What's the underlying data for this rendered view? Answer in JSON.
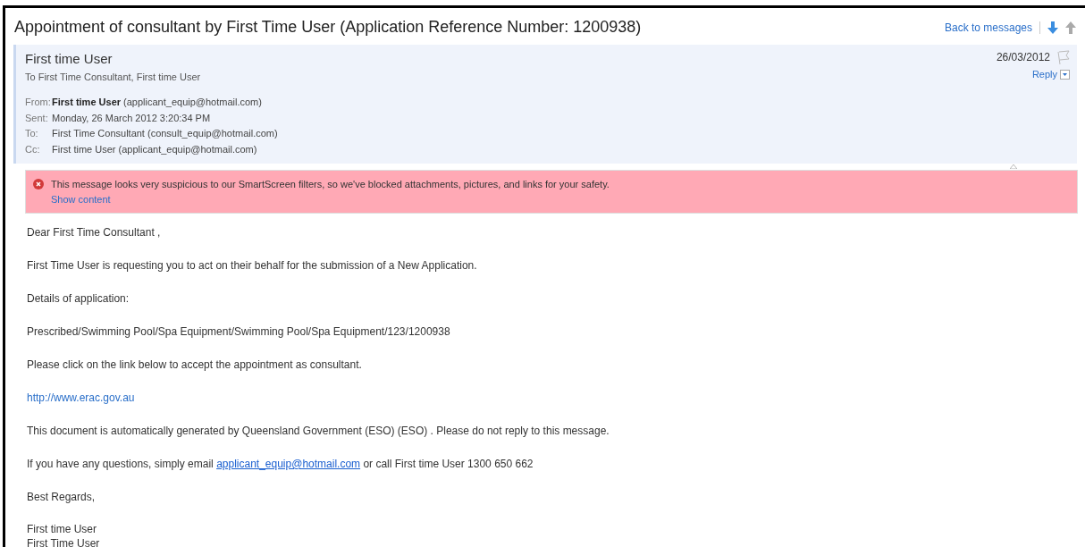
{
  "subject": "Appointment of consultant by First Time User (Application Reference Number: 1200938)",
  "back_link": "Back to messages",
  "header": {
    "sender": "First time User",
    "recipients": "To First Time Consultant, First time User",
    "date": "26/03/2012",
    "reply": "Reply",
    "details": [
      {
        "label": "From:",
        "bold": "First time User",
        "value": "(applicant_equip@hotmail.com)"
      },
      {
        "label": "Sent:",
        "value": "Monday, 26 March 2012 3:20:34 PM"
      },
      {
        "label": "To:",
        "value": "First Time Consultant (consult_equip@hotmail.com)"
      },
      {
        "label": "Cc:",
        "value": "First time User (applicant_equip@hotmail.com)"
      }
    ]
  },
  "warning": {
    "text": "This message looks very suspicious to our SmartScreen filters, so we've blocked attachments, pictures, and links for your safety.",
    "link": "Show content"
  },
  "body": [
    {
      "kind": "text",
      "text": "Dear First Time Consultant ,"
    },
    {
      "kind": "text",
      "text": "First Time User is requesting you to act on their behalf for the submission of a New Application."
    },
    {
      "kind": "text",
      "text": "Details of application:"
    },
    {
      "kind": "text",
      "text": "Prescribed/Swimming Pool/Spa Equipment/Swimming Pool/Spa Equipment/123/1200938"
    },
    {
      "kind": "text",
      "text": "Please click on the link below to accept the appointment as consultant."
    },
    {
      "kind": "link",
      "text": "http://www.erac.gov.au"
    },
    {
      "kind": "text",
      "text": "This document is automatically generated by Queensland Government (ESO) (ESO) . Please do not reply to this message."
    },
    {
      "kind": "email",
      "before": "If you have any questions, simply email",
      "link": "applicant_equip@hotmail.com",
      "after": "or call First time User 1300 650 662"
    },
    {
      "kind": "text",
      "text": "Best Regards,"
    },
    {
      "kind": "lines",
      "lines": [
        "First time User",
        "First Time User"
      ]
    }
  ]
}
